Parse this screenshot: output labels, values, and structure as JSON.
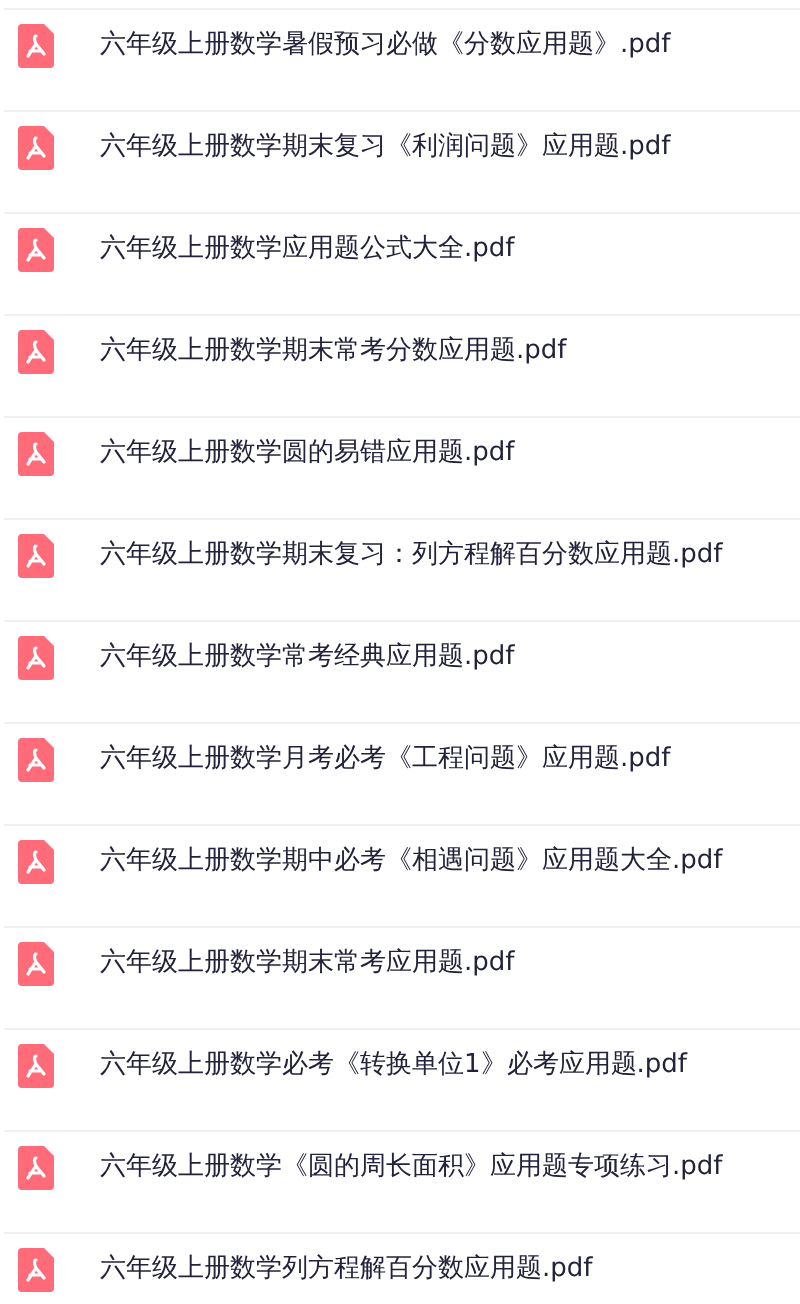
{
  "files": [
    {
      "name": "六年级上册数学暑假预习必做《分数应用题》.pdf"
    },
    {
      "name": "六年级上册数学期末复习《利润问题》应用题.pdf"
    },
    {
      "name": "六年级上册数学应用题公式大全.pdf"
    },
    {
      "name": "六年级上册数学期末常考分数应用题.pdf"
    },
    {
      "name": "六年级上册数学圆的易错应用题.pdf"
    },
    {
      "name": "六年级上册数学期末复习：列方程解百分数应用题.pdf"
    },
    {
      "name": "六年级上册数学常考经典应用题.pdf"
    },
    {
      "name": "六年级上册数学月考必考《工程问题》应用题.pdf"
    },
    {
      "name": "六年级上册数学期中必考《相遇问题》应用题大全.pdf"
    },
    {
      "name": "六年级上册数学期末常考应用题.pdf"
    },
    {
      "name": "六年级上册数学必考《转换单位1》必考应用题.pdf"
    },
    {
      "name": "六年级上册数学《圆的周长面积》应用题专项练习.pdf"
    },
    {
      "name": "六年级上册数学列方程解百分数应用题.pdf"
    }
  ]
}
